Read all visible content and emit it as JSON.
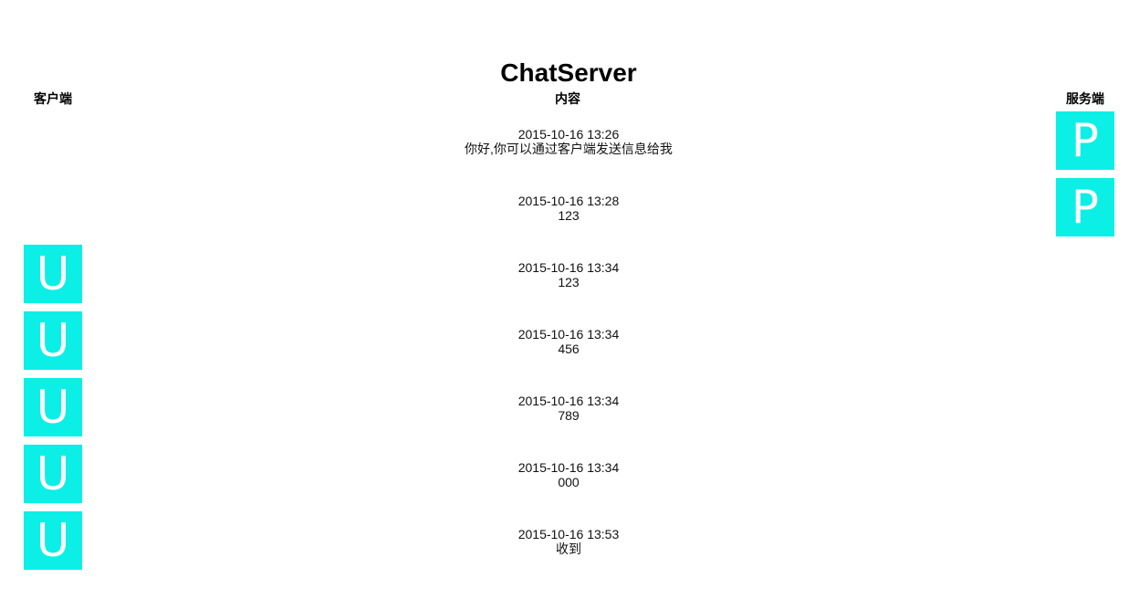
{
  "page": {
    "title": "ChatServer"
  },
  "columns": {
    "client": "客户端",
    "content": "内容",
    "server": "服务端"
  },
  "avatars": {
    "client_letter": "U",
    "server_letter": "P",
    "color": "#0cefe6"
  },
  "messages": [
    {
      "sender": "server",
      "time": "2015-10-16 13:26",
      "text": "你好,你可以通过客户端发送信息给我"
    },
    {
      "sender": "server",
      "time": "2015-10-16 13:28",
      "text": "123"
    },
    {
      "sender": "client",
      "time": "2015-10-16 13:34",
      "text": "123"
    },
    {
      "sender": "client",
      "time": "2015-10-16 13:34",
      "text": "456"
    },
    {
      "sender": "client",
      "time": "2015-10-16 13:34",
      "text": "789"
    },
    {
      "sender": "client",
      "time": "2015-10-16 13:34",
      "text": "000"
    },
    {
      "sender": "client",
      "time": "2015-10-16 13:53",
      "text": "收到"
    }
  ]
}
